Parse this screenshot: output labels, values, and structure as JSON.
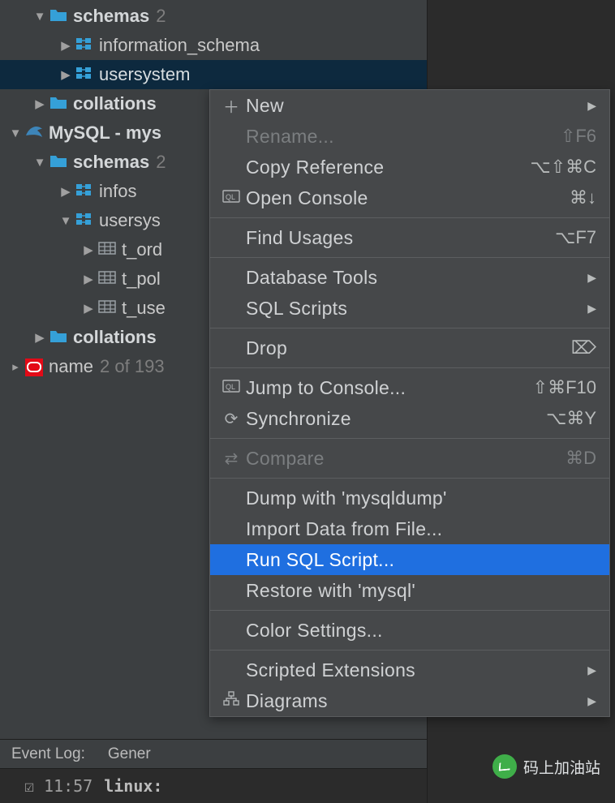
{
  "tree": {
    "schemas1": {
      "label": "schemas",
      "count": "2"
    },
    "info_schema": {
      "label": "information_schema"
    },
    "usersystem": {
      "label": "usersystem"
    },
    "collations1": {
      "label": "collations"
    },
    "mysql_conn": {
      "label": "MySQL - mys"
    },
    "schemas2": {
      "label": "schemas",
      "count": "2"
    },
    "infos": {
      "label": "infos"
    },
    "usersys2": {
      "label": "usersys"
    },
    "t_ord": {
      "label": "t_ord"
    },
    "t_pol": {
      "label": "t_pol"
    },
    "t_use": {
      "label": "t_use"
    },
    "collations2": {
      "label": "collations"
    },
    "name": {
      "label": "name",
      "count": "2 of 193"
    }
  },
  "tabs": {
    "eventlog": "Event Log:",
    "gener": "Gener"
  },
  "log": {
    "time": "11:57",
    "text": "linux:"
  },
  "menu": {
    "new": "New",
    "rename": "Rename...",
    "rename_sc": "⇧F6",
    "copyref": "Copy Reference",
    "copyref_sc": "⌥⇧⌘C",
    "openconsole": "Open Console",
    "openconsole_sc": "⌘↓",
    "findusages": "Find Usages",
    "findusages_sc": "⌥F7",
    "dbtools": "Database Tools",
    "sqlscripts": "SQL Scripts",
    "drop": "Drop",
    "drop_sc": "⌦",
    "jump": "Jump to Console...",
    "jump_sc": "⇧⌘F10",
    "sync": "Synchronize",
    "sync_sc": "⌥⌘Y",
    "compare": "Compare",
    "compare_sc": "⌘D",
    "dump": "Dump with 'mysqldump'",
    "import": "Import Data from File...",
    "runsql": "Run SQL Script...",
    "restore": "Restore with 'mysql'",
    "colorsettings": "Color Settings...",
    "scripted": "Scripted Extensions",
    "diagrams": "Diagrams"
  },
  "watermark": "码上加油站"
}
